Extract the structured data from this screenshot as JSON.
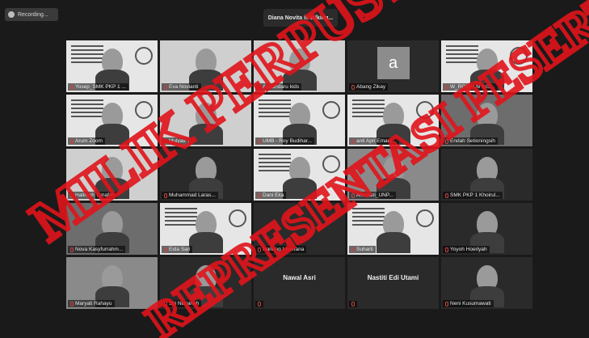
{
  "header": {
    "recording_label": "Recording...",
    "talking_label": "Diana Novita is talking..."
  },
  "participants": [
    {
      "name": "Yosep_SMK PKP 1 ...",
      "bg": "poster",
      "face": true
    },
    {
      "name": "Eva Novianti",
      "bg": "light",
      "face": true
    },
    {
      "name": "Adriandaru kids",
      "bg": "light",
      "face": true
    },
    {
      "name": "Abang Zikay",
      "bg": "dark",
      "avatar": "a"
    },
    {
      "name": "W_ROBIN M INS...",
      "bg": "poster",
      "face": true
    },
    {
      "name": "Arum Zoom",
      "bg": "poster",
      "face": true
    },
    {
      "name": "Mulyati",
      "bg": "light",
      "face": true
    },
    {
      "name": "UMB - Roy Budihar...",
      "bg": "poster",
      "face": true
    },
    {
      "name": "anti Apri Emara...",
      "bg": "poster",
      "face": true
    },
    {
      "name": "Endah Setioningsih",
      "bg": "room",
      "face": true
    },
    {
      "name": "Halimah Tunafah",
      "bg": "light",
      "face": true
    },
    {
      "name": "Muhammad Laras...",
      "bg": "dark",
      "face": true
    },
    {
      "name": "Dani Eka",
      "bg": "poster",
      "face": true
    },
    {
      "name": "Andriani_UNP...",
      "bg": "mid",
      "face": true
    },
    {
      "name": "SMK PKP 1 Khoirul...",
      "bg": "dark",
      "face": true
    },
    {
      "name": "Nova Kasyfurrahm...",
      "bg": "room",
      "face": true
    },
    {
      "name": "Eida Sari",
      "bg": "poster",
      "face": true
    },
    {
      "name": "Nanang Lesmana",
      "bg": "dark",
      "face": false
    },
    {
      "name": "Suharti",
      "bg": "poster",
      "face": true
    },
    {
      "name": "Yoyoh Hoeriyah",
      "bg": "dark",
      "face": true
    },
    {
      "name": "Maryati Rahayu",
      "bg": "mid",
      "face": true
    },
    {
      "name": "Siti Nurjanah",
      "bg": "dark",
      "face": true
    },
    {
      "name": "",
      "bg": "dark",
      "center": "Nawal Asri"
    },
    {
      "name": "",
      "bg": "dark",
      "center": "Nastiti Edi Utami"
    },
    {
      "name": "Neni Kusumawati",
      "bg": "dark",
      "face": true
    }
  ],
  "watermark": {
    "text_primary": "MILIK PERPUSTAKAAN",
    "text_secondary": "REPRESENTASI PESERTA",
    "color": "#e0141b"
  },
  "colors": {
    "background": "#1a1a1a",
    "tile": "#262626",
    "watermark": "#e0141b"
  }
}
